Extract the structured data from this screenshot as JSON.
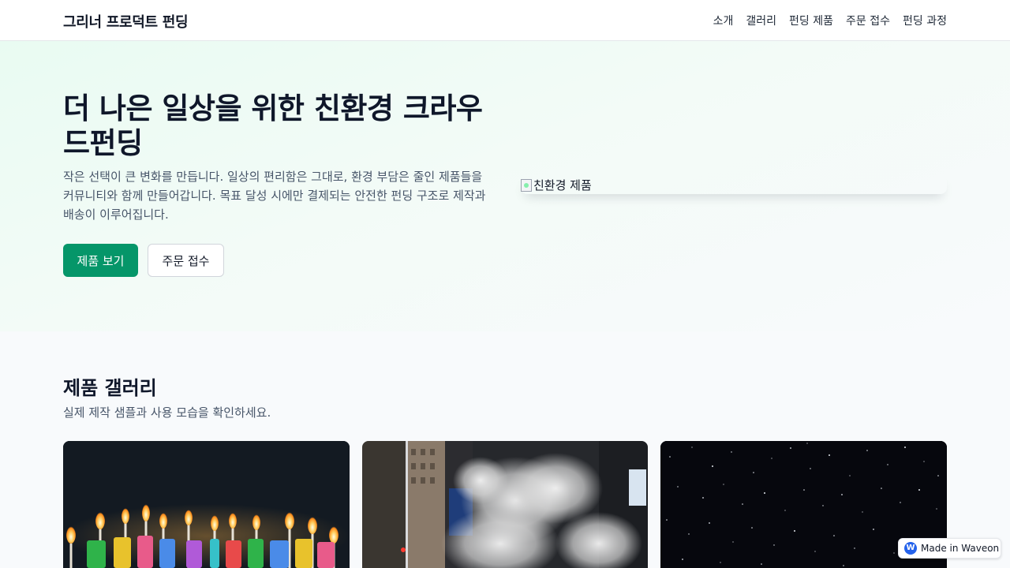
{
  "header": {
    "brand": "그리너 프로덕트 펀딩",
    "nav": [
      "소개",
      "갤러리",
      "펀딩 제품",
      "주문 접수",
      "펀딩 과정"
    ]
  },
  "hero": {
    "title": "더 나은 일상을 위한 친환경 크라우드펀딩",
    "description": "작은 선택이 큰 변화를 만듭니다. 일상의 편리함은 그대로, 환경 부담은 줄인 제품들을 커뮤니티와 함께 만들어갑니다. 목표 달성 시에만 결제되는 안전한 펀딩 구조로 제작과 배송이 이루어집니다.",
    "primary_button": "제품 보기",
    "secondary_button": "주문 접수",
    "image_alt": "친환경 제품"
  },
  "gallery": {
    "title": "제품 갤러리",
    "subtitle": "실제 제작 샘플과 사용 모습을 확인하세요."
  },
  "badge": {
    "icon_letter": "W",
    "text": "Made in Waveon"
  },
  "colors": {
    "accent": "#059669",
    "badge_blue": "#2563eb"
  }
}
